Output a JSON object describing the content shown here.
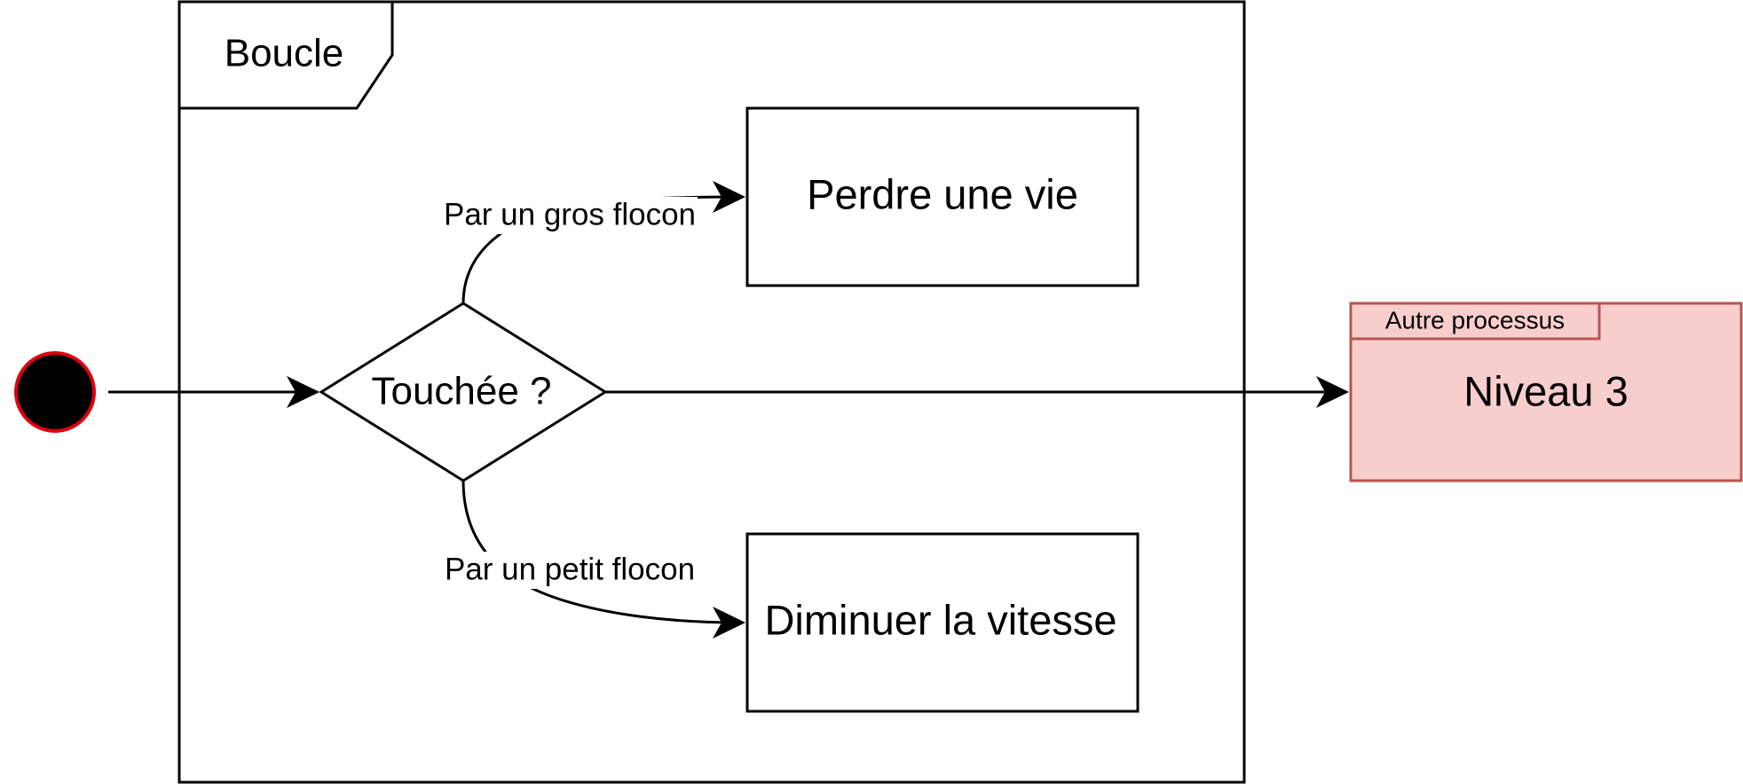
{
  "frame": {
    "title": "Boucle"
  },
  "nodes": {
    "start": {
      "kind": "initial-node"
    },
    "decision": {
      "label": "Touchée ?"
    },
    "lose_life": {
      "label": "Perdre une vie"
    },
    "reduce_speed": {
      "label": "Diminuer la vitesse"
    },
    "next_process": {
      "tab_label": "Autre processus",
      "label": "Niveau 3"
    }
  },
  "edges": {
    "big_flake": {
      "label": "Par un gros flocon"
    },
    "small_flake": {
      "label": "Par un petit flocon"
    }
  },
  "colors": {
    "stroke": "#000000",
    "initial_fill": "#000000",
    "initial_border": "#e0000f",
    "process_fill": "#f8cecc",
    "process_border": "#b85450"
  }
}
